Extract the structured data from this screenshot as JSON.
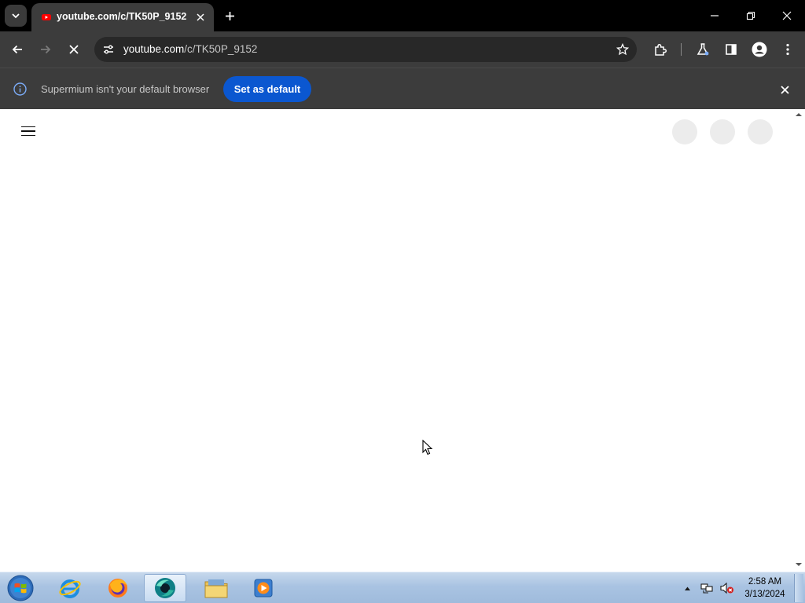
{
  "browser": {
    "tab": {
      "title": "youtube.com/c/TK50P_9152",
      "favicon": "youtube-icon"
    },
    "omnibox": {
      "host": "youtube.com",
      "path": "/c/TK50P_9152"
    },
    "infobar": {
      "message": "Supermium isn't your default browser",
      "button_label": "Set as default"
    }
  },
  "taskbar": {
    "clock": {
      "time": "2:58 AM",
      "date": "3/13/2024"
    },
    "apps": [
      {
        "name": "internet-explorer"
      },
      {
        "name": "firefox"
      },
      {
        "name": "supermium",
        "active": true
      },
      {
        "name": "file-explorer"
      },
      {
        "name": "media-player"
      }
    ]
  },
  "colors": {
    "tabstrip": "#000000",
    "toolbar": "#3c3c3c",
    "accent_button": "#0b57d0",
    "info_icon": "#7cacf8",
    "placeholder": "#ececec"
  }
}
